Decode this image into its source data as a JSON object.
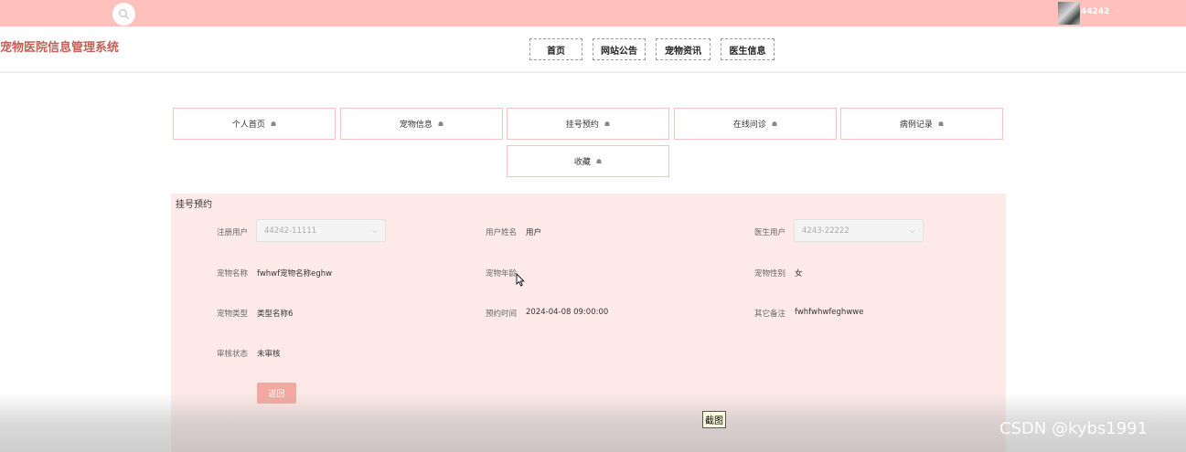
{
  "colors": {
    "accent": "#fec1bc",
    "title": "#c06056",
    "panel_bg": "#fdeae8",
    "button": "#f6a7a1"
  },
  "topbar": {
    "username": "44242",
    "caret": "-",
    "search_icon": "search-icon"
  },
  "header": {
    "site_title": "宠物医院信息管理系统",
    "nav": [
      "首页",
      "网站公告",
      "宠物资讯",
      "医生信息"
    ]
  },
  "menu": {
    "items": [
      "个人首页",
      "宠物信息",
      "挂号预约",
      "在线问诊",
      "病例记录",
      "收藏"
    ],
    "item_icon": "home-icon",
    "icon_glyph": "☗"
  },
  "form": {
    "title": "挂号预约",
    "fields": {
      "register_user": {
        "label": "注册用户",
        "value": "44242-11111"
      },
      "user_name": {
        "label": "用户姓名",
        "value": "用户"
      },
      "doctor_user": {
        "label": "医生用户",
        "value": "4243-22222"
      },
      "pet_name": {
        "label": "宠物名称",
        "value": "fwhwf宠物名称eghw"
      },
      "pet_age": {
        "label": "宠物年龄",
        "value": ""
      },
      "pet_gender": {
        "label": "宠物性别",
        "value": "女"
      },
      "pet_type": {
        "label": "宠物类型",
        "value": "类型名称6"
      },
      "appointment_time": {
        "label": "预约时间",
        "value": "2024-04-08 09:00:00"
      },
      "remarks": {
        "label": "其它备注",
        "value": "fwhfwhwfeghwwe"
      },
      "review_status": {
        "label": "审核状态",
        "value": "未审核"
      }
    },
    "back_button": "返回",
    "chevron": "⌵"
  },
  "overlay": {
    "screenshot_tip": "截图",
    "watermark": "CSDN @kybs1991"
  }
}
